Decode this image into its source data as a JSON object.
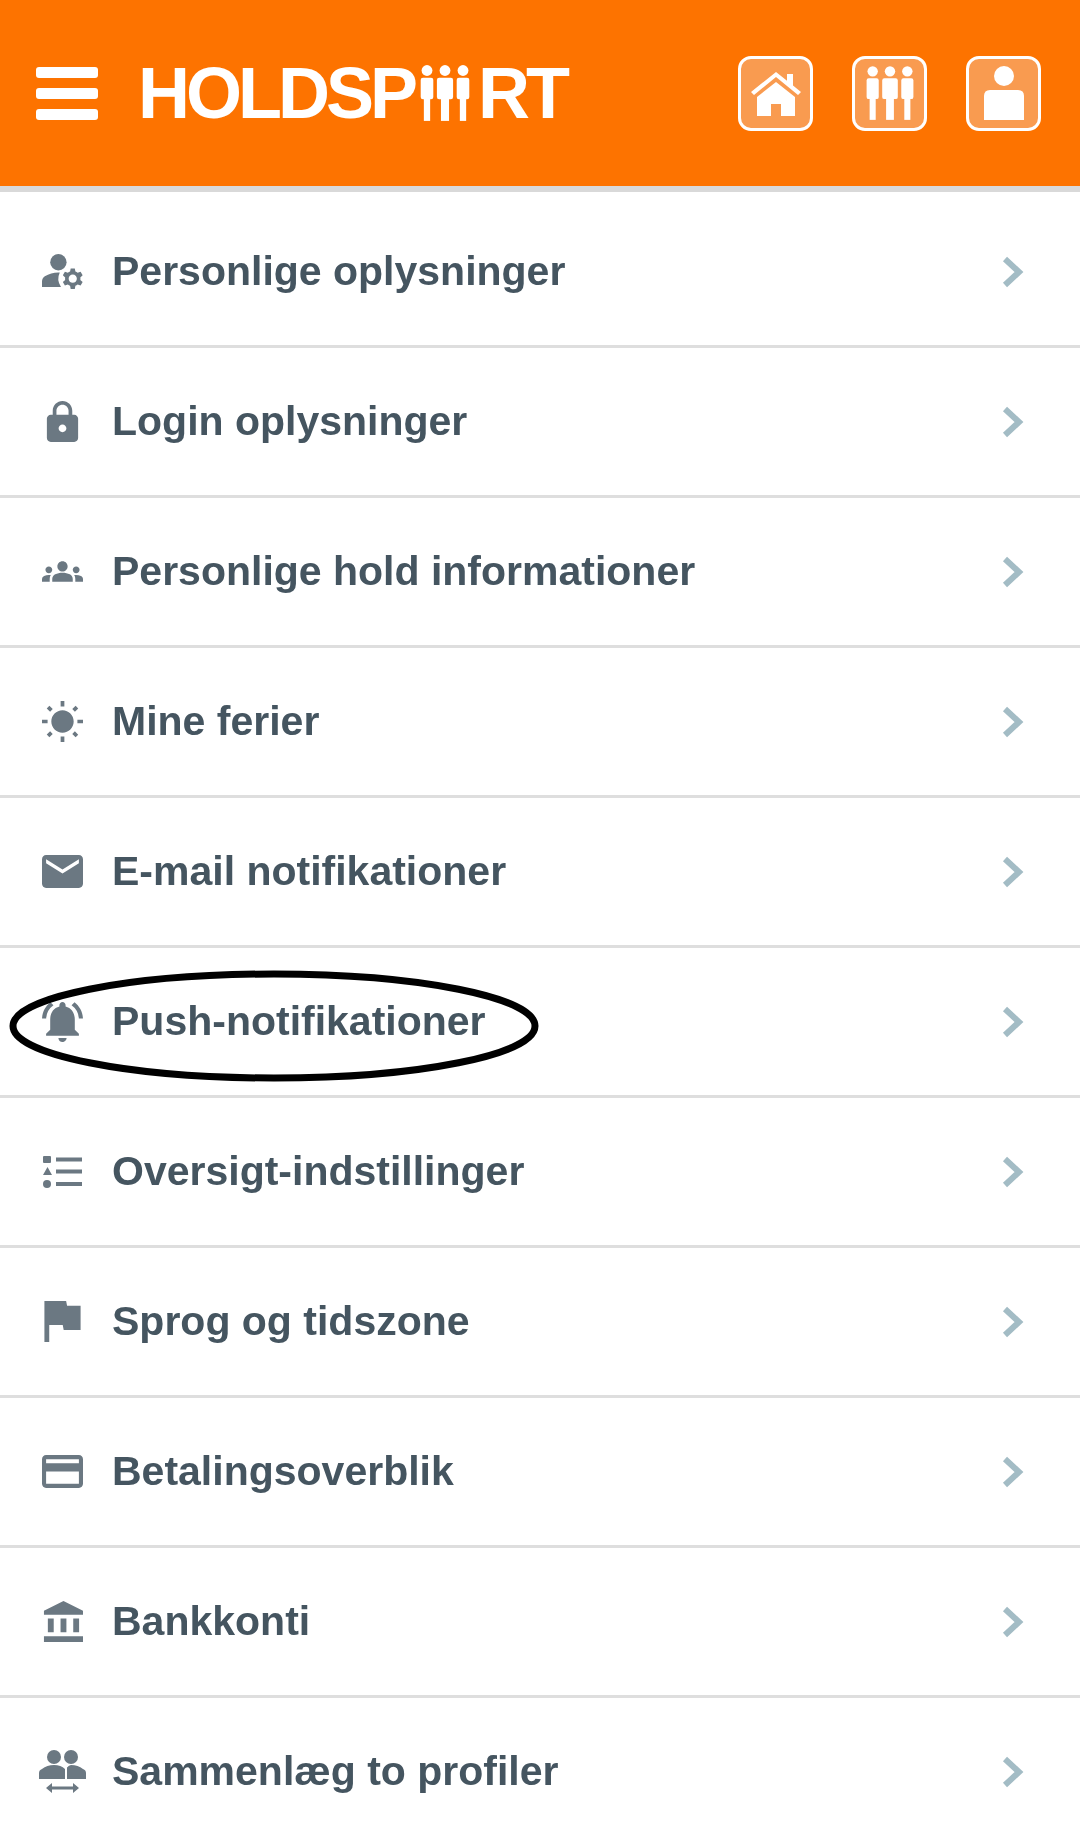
{
  "header": {
    "logo": {
      "before": "HOLDSP",
      "after": "RT"
    },
    "buttons": [
      {
        "kind": "home"
      },
      {
        "kind": "team"
      },
      {
        "kind": "profile"
      }
    ]
  },
  "menu": {
    "items": [
      {
        "kind": "personal",
        "label": "Personlige oplysninger",
        "circled": false
      },
      {
        "kind": "login",
        "label": "Login oplysninger",
        "circled": false
      },
      {
        "kind": "teams",
        "label": "Personlige hold informationer",
        "circled": false
      },
      {
        "kind": "holidays",
        "label": "Mine ferier",
        "circled": false
      },
      {
        "kind": "email",
        "label": "E-mail notifikationer",
        "circled": false
      },
      {
        "kind": "push",
        "label": "Push-notifikationer",
        "circled": true
      },
      {
        "kind": "overview",
        "label": "Oversigt-indstillinger",
        "circled": false
      },
      {
        "kind": "language",
        "label": "Sprog og tidszone",
        "circled": false
      },
      {
        "kind": "payments",
        "label": "Betalingsoverblik",
        "circled": false
      },
      {
        "kind": "banking",
        "label": "Bankkonti",
        "circled": false
      },
      {
        "kind": "merge",
        "label": "Sammenlæg to profiler",
        "circled": false
      }
    ]
  }
}
